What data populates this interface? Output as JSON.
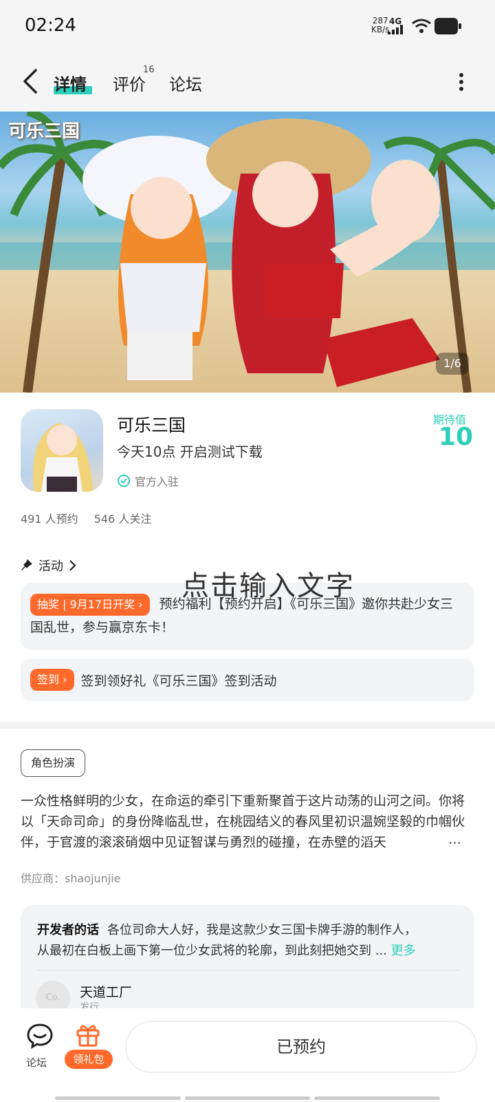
{
  "status_bar": {
    "time": "02:24",
    "speed_value": "287",
    "speed_unit": "KB/s",
    "network": "4G"
  },
  "nav": {
    "tabs": [
      {
        "label": "详情"
      },
      {
        "label": "评价",
        "badge": "16"
      },
      {
        "label": "论坛"
      }
    ]
  },
  "banner": {
    "logo_text": "可乐三国",
    "counter": "1/6"
  },
  "app": {
    "name": "可乐三国",
    "subtitle": "今天10点 开启测试下载",
    "official": "官方入驻",
    "expect_label": "期待值",
    "expect_value": "10",
    "reservations": "491 人预约",
    "followers": "546 人关注"
  },
  "activity": {
    "title": "活动",
    "overlay_text": "点击输入文字",
    "items": [
      {
        "tag": "抽奖 | 9月17日开奖",
        "text": "预约福利【预约开启】《可乐三国》邀你共赴少女三国乱世，参与赢京东卡！"
      },
      {
        "tag": "签到",
        "text": "签到领好礼《可乐三国》签到活动"
      }
    ]
  },
  "description": {
    "tag": "角色扮演",
    "text": "一众性格鲜明的少女，在命运的牵引下重新聚首于这片动荡的山河之间。你将以「天命司命」的身份降临乱世，在桃园结义的春风里初识温婉坚毅的巾帼伙伴，于官渡的滚滚硝烟中见证智谋与勇烈的碰撞，在赤壁的滔天",
    "ellipsis": "…",
    "supplier": "供应商：shaojunjie"
  },
  "developer": {
    "label": "开发者的话",
    "line1": "各位司命大人好，我是这款少女三国卡牌手游的制作人，",
    "line2": "从最初在白板上画下第一位少女武将的轮廓，到此刻把她交到 ...",
    "more": "更多",
    "avatar_text": "Co.",
    "name": "天道工厂",
    "role": "发行"
  },
  "bottom": {
    "forum": "论坛",
    "gift": "领礼包",
    "reserved": "已预约"
  },
  "colors": {
    "accent": "#2ccfb9",
    "orange": "#ff6a2c"
  }
}
